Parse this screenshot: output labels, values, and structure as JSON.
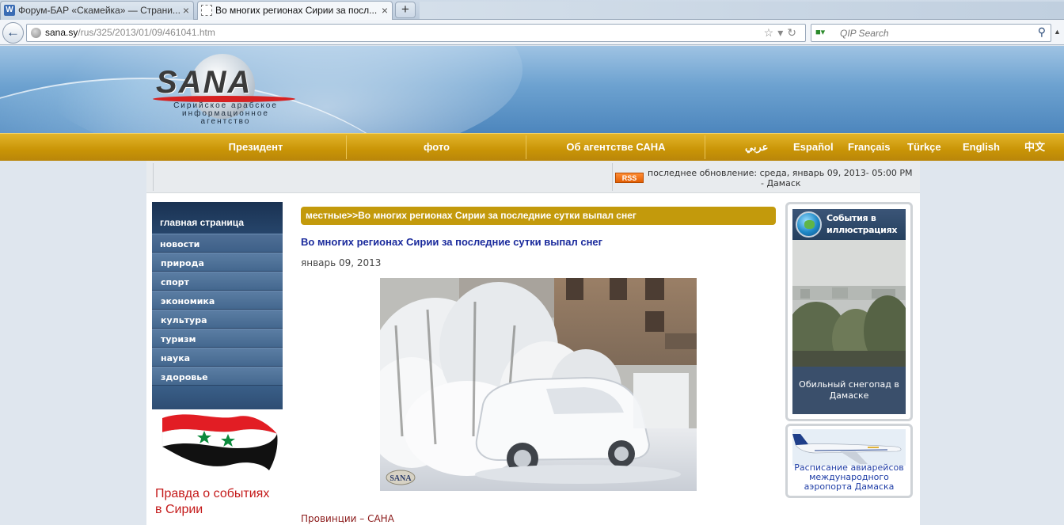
{
  "browser": {
    "tabs": [
      {
        "title": "Форум-БАР «Скамейка» — Страни...",
        "favicon": "w-icon",
        "active": false
      },
      {
        "title": "Во многих регионах Сирии за посл...",
        "favicon": "blank-page-icon",
        "active": true
      }
    ],
    "new_tab_label": "+",
    "close_label": "×",
    "url_host": "sana.sy",
    "url_path": "/rus/325/2013/01/09/461041.htm",
    "search_placeholder": "QIP Search",
    "icons": {
      "back": "back-arrow-icon",
      "star": "bookmark-star-icon",
      "reload": "reload-icon",
      "search": "magnifier-icon"
    }
  },
  "site": {
    "logo_text": "SANA",
    "logo_subtitle": "Сирийское арабское информационное агентство",
    "menu": [
      {
        "label": "Президент"
      },
      {
        "label": "фото"
      },
      {
        "label": "Об агентстве САНА"
      }
    ],
    "languages": [
      "عربي",
      "Español",
      "Français",
      "Türkçe",
      "English",
      "中文"
    ],
    "rss_label": "RSS",
    "last_update": "последнее обновление: среда, январь 09, 2013- 05:00 PM",
    "last_update_place": "- Дамаск",
    "colors": {
      "menu_gold": "#c99406",
      "nav_blue": "#2e4d73",
      "title_blue": "#1a2a9c",
      "crumb_gold": "#c39a0c"
    }
  },
  "nav": {
    "home": "главная страница",
    "items": [
      "новости",
      "природа",
      "спорт",
      "экономика",
      "культура",
      "туризм",
      "наука",
      "здоровье"
    ]
  },
  "promo": {
    "truth_line1": "Правда о событиях",
    "truth_line2": "в Сирии"
  },
  "article": {
    "breadcrumb": "местные>>Во многих регионах Сирии за последние сутки выпал снег",
    "title": "Во многих регионах Сирии за последние сутки выпал снег",
    "date": "январь 09, 2013",
    "photo_watermark": "SANA",
    "source": "Провинции – САНА"
  },
  "sidebar": {
    "gallery_title_1": "События в",
    "gallery_title_2": "иллюстрациях",
    "gallery_caption": "Обильный снегопад в Дамаске",
    "airline_caption": "Расписание авиарейсов международного аэропорта Дамаска"
  }
}
